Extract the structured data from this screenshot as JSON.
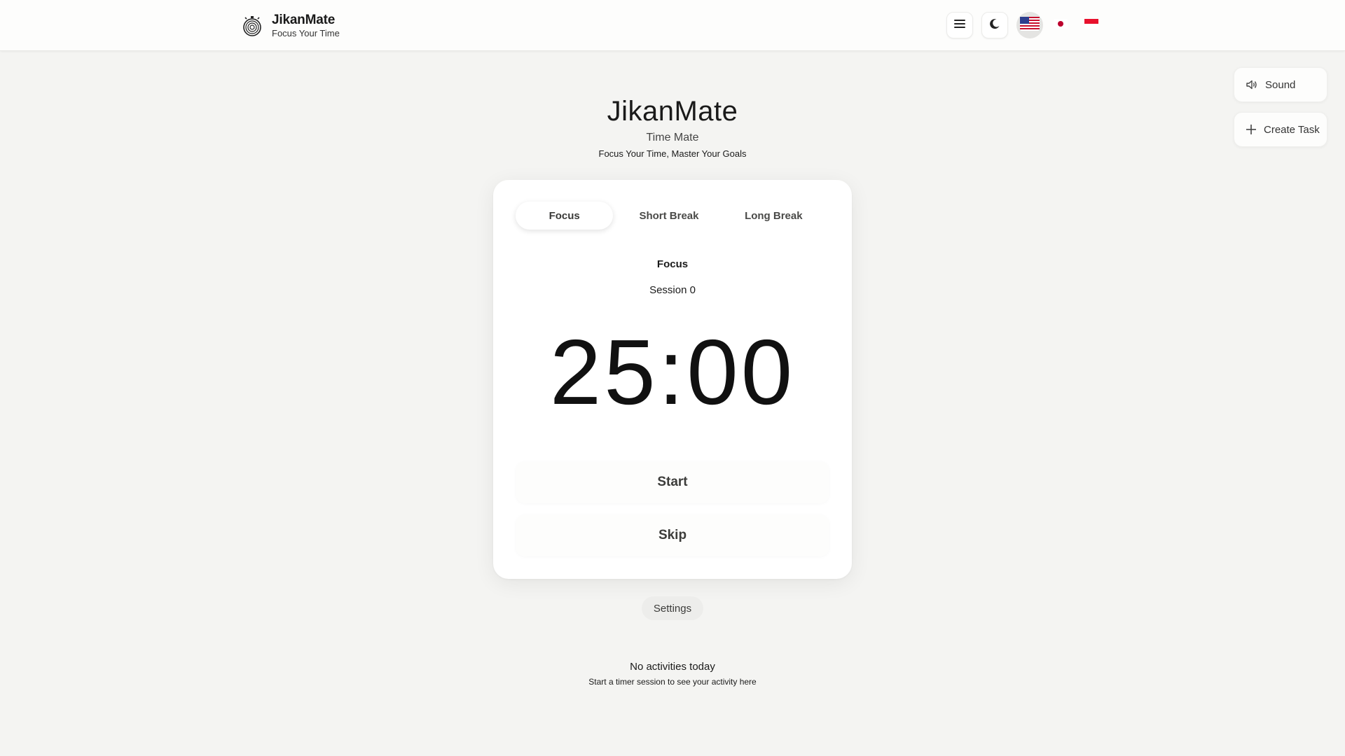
{
  "header": {
    "brand_name": "JikanMate",
    "brand_tagline": "Focus Your Time",
    "icons": {
      "menu": "menu-icon",
      "theme": "moon-icon",
      "flags": [
        "us-flag-icon",
        "japan-flag-icon",
        "indonesia-flag-icon"
      ]
    }
  },
  "floating": {
    "sound_label": "Sound",
    "create_task_label": "Create Task"
  },
  "hero": {
    "title": "JikanMate",
    "subtitle": "Time Mate",
    "tagline": "Focus Your Time, Master Your Goals"
  },
  "timer_card": {
    "tabs": [
      {
        "label": "Focus",
        "active": true
      },
      {
        "label": "Short Break",
        "active": false
      },
      {
        "label": "Long Break",
        "active": false
      }
    ],
    "mode": "Focus",
    "session": "Session 0",
    "time": "25:00",
    "start_label": "Start",
    "skip_label": "Skip"
  },
  "settings_label": "Settings",
  "activity": {
    "title": "No activities today",
    "subtitle": "Start a timer session to see your activity here"
  },
  "colors": {
    "background": "#f4f4f2",
    "card": "#ffffff",
    "text": "#1a1a1a"
  }
}
